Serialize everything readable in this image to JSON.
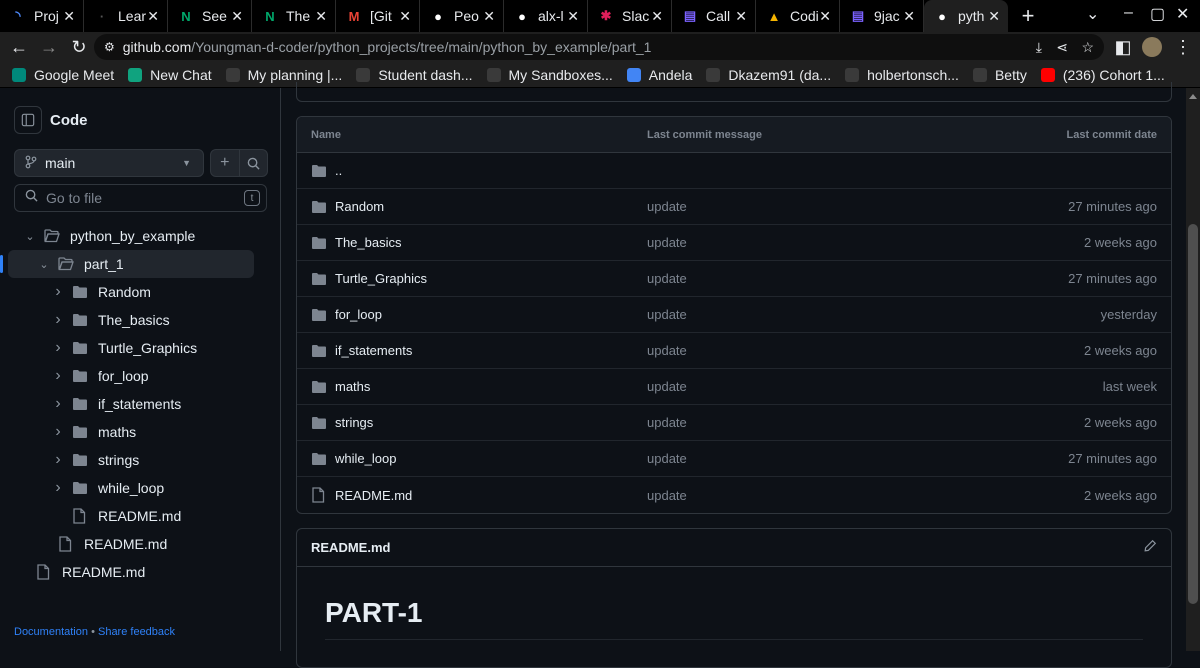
{
  "browser": {
    "tabs": [
      {
        "title": "Proj",
        "icon": "loading-icon",
        "color": "#4f8cff",
        "glyph": "◝"
      },
      {
        "title": "Lear",
        "icon": "alx-icon",
        "color": "#555555",
        "glyph": "·"
      },
      {
        "title": "See",
        "icon": "n-icon",
        "color": "#00a86b",
        "glyph": "N"
      },
      {
        "title": "The",
        "icon": "n-icon",
        "color": "#00a86b",
        "glyph": "N"
      },
      {
        "title": "[Git",
        "icon": "gmail-icon",
        "color": "#ea4335",
        "glyph": "M"
      },
      {
        "title": "Peo",
        "icon": "github-icon",
        "color": "#ffffff",
        "glyph": "●"
      },
      {
        "title": "alx-l",
        "icon": "github-icon",
        "color": "#ffffff",
        "glyph": "●"
      },
      {
        "title": "Slac",
        "icon": "slack-icon",
        "color": "#e01e5a",
        "glyph": "✱"
      },
      {
        "title": "Call",
        "icon": "calendar-icon",
        "color": "#7b61ff",
        "glyph": "▤"
      },
      {
        "title": "Codi",
        "icon": "code-icon",
        "color": "#f5b400",
        "glyph": "▲"
      },
      {
        "title": "9jac",
        "icon": "calendar-icon",
        "color": "#7b61ff",
        "glyph": "▤"
      },
      {
        "title": "pyth",
        "icon": "github-icon",
        "color": "#ffffff",
        "glyph": "●"
      }
    ],
    "url_host": "github.com",
    "url_path": "/Youngman-d-coder/python_projects/tree/main/python_by_example/part_1",
    "bookmarks": [
      {
        "label": "Google Meet",
        "icon": "meet-icon",
        "color": "#00897b"
      },
      {
        "label": "New Chat",
        "icon": "chatgpt-icon",
        "color": "#10a37f"
      },
      {
        "label": "My planning |...",
        "icon": "alx-icon",
        "color": "#3a3a3a"
      },
      {
        "label": "Student dash...",
        "icon": "alx-icon",
        "color": "#3a3a3a"
      },
      {
        "label": "My Sandboxes...",
        "icon": "alx-icon",
        "color": "#3a3a3a"
      },
      {
        "label": "Andela",
        "icon": "google-icon",
        "color": "#4285f4"
      },
      {
        "label": "Dkazem91 (da...",
        "icon": "github-icon",
        "color": "#3a3a3a"
      },
      {
        "label": "holbertonsch...",
        "icon": "github-icon",
        "color": "#3a3a3a"
      },
      {
        "label": "Betty",
        "icon": "github-icon",
        "color": "#3a3a3a"
      },
      {
        "label": "(236) Cohort 1...",
        "icon": "youtube-icon",
        "color": "#ff0000"
      }
    ]
  },
  "sidebar": {
    "title": "Code",
    "branch": "main",
    "search_placeholder": "Go to file",
    "shortcut": "t",
    "tree": [
      {
        "label": "python_by_example",
        "type": "folder-open",
        "level": 1,
        "chevron": "down"
      },
      {
        "label": "part_1",
        "type": "folder-open",
        "level": 2,
        "chevron": "down",
        "selected": true
      },
      {
        "label": "Random",
        "type": "folder",
        "level": 3,
        "chevron": "right"
      },
      {
        "label": "The_basics",
        "type": "folder",
        "level": 3,
        "chevron": "right"
      },
      {
        "label": "Turtle_Graphics",
        "type": "folder",
        "level": 3,
        "chevron": "right"
      },
      {
        "label": "for_loop",
        "type": "folder",
        "level": 3,
        "chevron": "right"
      },
      {
        "label": "if_statements",
        "type": "folder",
        "level": 3,
        "chevron": "right"
      },
      {
        "label": "maths",
        "type": "folder",
        "level": 3,
        "chevron": "right"
      },
      {
        "label": "strings",
        "type": "folder",
        "level": 3,
        "chevron": "right"
      },
      {
        "label": "while_loop",
        "type": "folder",
        "level": 3,
        "chevron": "right"
      },
      {
        "label": "README.md",
        "type": "file",
        "level": 3
      },
      {
        "label": "README.md",
        "type": "file",
        "level": 2
      },
      {
        "label": "README.md",
        "type": "file",
        "level": 1
      }
    ],
    "footer": {
      "docs": "Documentation",
      "separator": "•",
      "feedback": "Share feedback"
    }
  },
  "table": {
    "headers": [
      "Name",
      "Last commit message",
      "Last commit date"
    ],
    "rows": [
      {
        "name": "..",
        "type": "folder",
        "message": "",
        "date": ""
      },
      {
        "name": "Random",
        "type": "folder",
        "message": "update",
        "date": "27 minutes ago"
      },
      {
        "name": "The_basics",
        "type": "folder",
        "message": "update",
        "date": "2 weeks ago"
      },
      {
        "name": "Turtle_Graphics",
        "type": "folder",
        "message": "update",
        "date": "27 minutes ago"
      },
      {
        "name": "for_loop",
        "type": "folder",
        "message": "update",
        "date": "yesterday"
      },
      {
        "name": "if_statements",
        "type": "folder",
        "message": "update",
        "date": "2 weeks ago"
      },
      {
        "name": "maths",
        "type": "folder",
        "message": "update",
        "date": "last week"
      },
      {
        "name": "strings",
        "type": "folder",
        "message": "update",
        "date": "2 weeks ago"
      },
      {
        "name": "while_loop",
        "type": "folder",
        "message": "update",
        "date": "27 minutes ago"
      },
      {
        "name": "README.md",
        "type": "file",
        "message": "update",
        "date": "2 weeks ago"
      }
    ]
  },
  "readme": {
    "header": "README.md",
    "heading": "PART-1"
  }
}
